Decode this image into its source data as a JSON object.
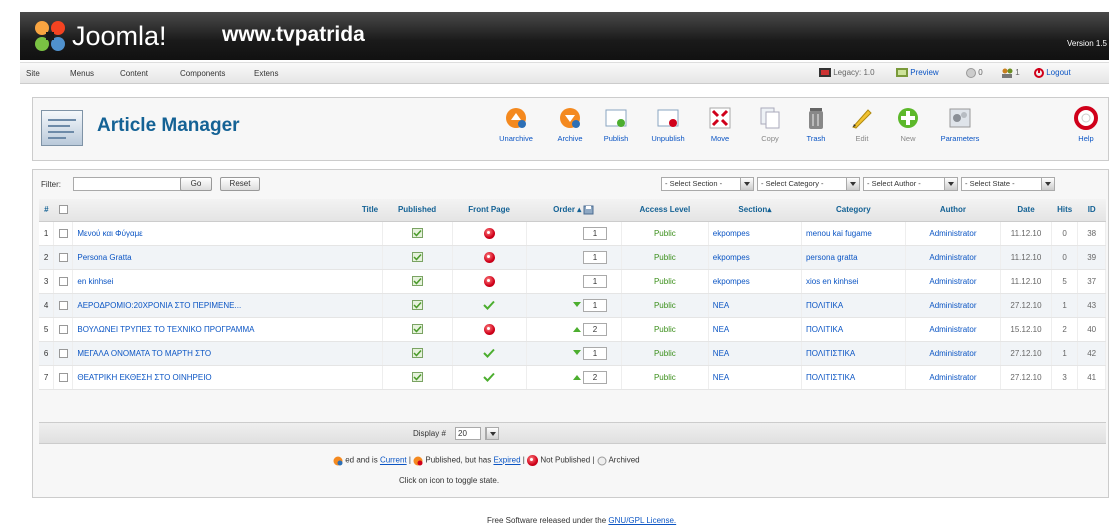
{
  "header": {
    "logo_text": "Joomla!",
    "site_name": "www.tvpatrida",
    "version": "Version 1.5"
  },
  "menubar": {
    "items": [
      "Site",
      "Menus",
      "Content",
      "Components",
      "Extens"
    ],
    "legacy": "Legacy: 1.0",
    "preview": "Preview",
    "messages": "0",
    "users": "1",
    "logout": "Logout"
  },
  "toolbar": {
    "title": "Article Manager",
    "buttons": [
      {
        "label": "Unarchive",
        "icon": "unarchive-icon"
      },
      {
        "label": "Archive",
        "icon": "archive-icon"
      },
      {
        "label": "Publish",
        "icon": "publish-icon"
      },
      {
        "label": "Unpublish",
        "icon": "unpublish-icon"
      },
      {
        "label": "Move",
        "icon": "move-icon"
      },
      {
        "label": "Copy",
        "icon": "copy-icon"
      },
      {
        "label": "Trash",
        "icon": "trash-icon"
      },
      {
        "label": "Edit",
        "icon": "edit-icon"
      },
      {
        "label": "New",
        "icon": "new-icon"
      },
      {
        "label": "Parameters",
        "icon": "parameters-icon"
      },
      {
        "label": "Help",
        "icon": "help-icon"
      }
    ]
  },
  "filter": {
    "label": "Filter:",
    "value": "",
    "go": "Go",
    "reset": "Reset",
    "selects": [
      "- Select Section -",
      "- Select Category -",
      "- Select Author -",
      "- Select State -"
    ]
  },
  "table": {
    "headers": {
      "num": "#",
      "title": "Title",
      "published": "Published",
      "front_page": "Front Page",
      "order": "Order",
      "access": "Access Level",
      "section": "Section",
      "category": "Category",
      "author": "Author",
      "date": "Date",
      "hits": "Hits",
      "id": "ID"
    },
    "rows": [
      {
        "num": "1",
        "title": "Μενού και Φύγαμε",
        "published": "yes",
        "front": "no",
        "order_up": false,
        "order_down": false,
        "order": "1",
        "access": "Public",
        "section": "ekpompes",
        "category": "menou kai fugame",
        "author": "Administrator",
        "date": "11.12.10",
        "hits": "0",
        "id": "38"
      },
      {
        "num": "2",
        "title": "Persona Gratta",
        "published": "yes",
        "front": "no",
        "order_up": false,
        "order_down": false,
        "order": "1",
        "access": "Public",
        "section": "ekpompes",
        "category": "persona gratta",
        "author": "Administrator",
        "date": "11.12.10",
        "hits": "0",
        "id": "39"
      },
      {
        "num": "3",
        "title": "en kinhsei",
        "published": "yes",
        "front": "no",
        "order_up": false,
        "order_down": false,
        "order": "1",
        "access": "Public",
        "section": "ekpompes",
        "category": "xios en kinhsei",
        "author": "Administrator",
        "date": "11.12.10",
        "hits": "5",
        "id": "37"
      },
      {
        "num": "4",
        "title": "ΑΕΡΟΔΡΟΜΙΟ:20ΧΡΟΝΙΑ ΣΤΟ ΠΕΡΙΜΕΝΕ...",
        "published": "yes",
        "front": "yes",
        "order_up": false,
        "order_down": true,
        "order": "1",
        "access": "Public",
        "section": "NEA",
        "category": "ΠΟΛΙΤΙΚΑ",
        "author": "Administrator",
        "date": "27.12.10",
        "hits": "1",
        "id": "43"
      },
      {
        "num": "5",
        "title": "ΒΟΥΛΩΝΕΙ ΤΡΥΠΕΣ ΤΟ ΤΕΧΝΙΚΟ ΠΡΟΓΡΑΜΜΑ",
        "published": "yes",
        "front": "no",
        "order_up": true,
        "order_down": false,
        "order": "2",
        "access": "Public",
        "section": "NEA",
        "category": "ΠΟΛΙΤΙΚΑ",
        "author": "Administrator",
        "date": "15.12.10",
        "hits": "2",
        "id": "40"
      },
      {
        "num": "6",
        "title": "ΜΕΓΑΛΑ ΟΝΟΜΑΤΑ ΤΟ ΜΑΡΤΗ ΣΤΟ",
        "published": "yes",
        "front": "yes",
        "order_up": false,
        "order_down": true,
        "order": "1",
        "access": "Public",
        "section": "NEA",
        "category": "ΠΟΛΙΤΙΣΤΙΚΑ",
        "author": "Administrator",
        "date": "27.12.10",
        "hits": "1",
        "id": "42"
      },
      {
        "num": "7",
        "title": "ΘΕΑΤΡΙΚΗ ΕΚΘΕΣΗ ΣΤΟ ΟΙΝΗΡΕΙΟ",
        "published": "yes",
        "front": "yes",
        "order_up": true,
        "order_down": false,
        "order": "2",
        "access": "Public",
        "section": "NEA",
        "category": "ΠΟΛΙΤΙΣΤΙΚΑ",
        "author": "Administrator",
        "date": "27.12.10",
        "hits": "3",
        "id": "41"
      }
    ]
  },
  "display": {
    "label": "Display #",
    "value": "20"
  },
  "legend": {
    "current_prefix": "ed and is",
    "current_link": "Current",
    "expired_text": "Published, but has",
    "expired_link": "Expired",
    "not_published": "Not Published",
    "archived": "Archived",
    "note": "Click on icon to toggle state."
  },
  "footer": {
    "prefix": "Free Software released under the",
    "link": "GNU/GPL License."
  },
  "colors": {
    "accent": "#146295",
    "link": "#0b55c4",
    "public_green": "#3a8f1a",
    "header_bg": "#1a1a1a"
  }
}
